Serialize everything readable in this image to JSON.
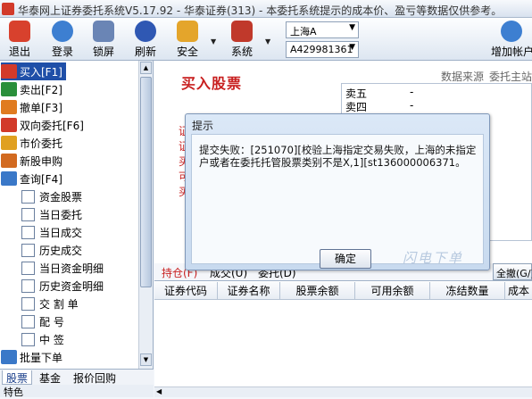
{
  "window": {
    "title": "华泰网上证券委托系统V5.17.92 - 华泰证券(313) - 本委托系统提示的成本价、盈亏等数据仅供参考。"
  },
  "toolbar": {
    "buttons": [
      {
        "label": "退出",
        "icon": "exit-icon",
        "color": "#d8412d"
      },
      {
        "label": "登录",
        "icon": "login-icon",
        "color": "#3d7fd1"
      },
      {
        "label": "锁屏",
        "icon": "lock-icon",
        "color": "#6a85b5"
      },
      {
        "label": "刷新",
        "icon": "refresh-icon",
        "color": "#2f58b3"
      },
      {
        "label": "安全",
        "icon": "security-icon",
        "color": "#e4a52b"
      },
      {
        "label": "系统",
        "icon": "system-icon",
        "color": "#c0392b"
      }
    ],
    "market": "上海A",
    "account": "A429981361",
    "add_account": "增加帐户"
  },
  "sidebar": {
    "items": [
      {
        "label": "买入[F1]",
        "icon": "buy-icon",
        "color": "#d23a2a"
      },
      {
        "label": "卖出[F2]",
        "icon": "sell-icon",
        "color": "#2a8f3a"
      },
      {
        "label": "撤单[F3]",
        "icon": "cancel-order-icon",
        "color": "#e07b20"
      },
      {
        "label": "双向委托[F6]",
        "icon": "dual-order-icon",
        "color": "#d23a2a"
      },
      {
        "label": "市价委托",
        "icon": "market-order-icon",
        "color": "#e0a020"
      },
      {
        "label": "新股申购",
        "icon": "ipo-icon",
        "color": "#d26a20"
      },
      {
        "label": "查询[F4]",
        "icon": "query-icon",
        "color": "#3a78c8"
      }
    ],
    "subitems": [
      "资金股票",
      "当日委托",
      "当日成交",
      "历史成交",
      "当日资金明细",
      "历史资金明细",
      "交 割 单",
      "配  号",
      "中  签"
    ],
    "batch": "批量下单",
    "tabs": [
      "股票",
      "基金",
      "报价回购"
    ],
    "status": "特色"
  },
  "main": {
    "heading": "买入股票",
    "source_label": "数据来源",
    "source_value": "委托主站",
    "form_labels": [
      "证",
      "证",
      "买",
      "可",
      "买"
    ],
    "orderbook": [
      {
        "label": "卖五",
        "value": "-"
      },
      {
        "label": "卖四",
        "value": "-"
      }
    ],
    "tabs": [
      "持仓(F)",
      "成交(U)",
      "委托(D)"
    ],
    "refresh_button": "全撤(G/)",
    "columns": [
      "证券代码",
      "证券名称",
      "股票余额",
      "可用余额",
      "冻结数量",
      "成本"
    ]
  },
  "dialog": {
    "title": "提示",
    "message": "提交失败：[251070][校验上海指定交易失败，上海的未指定户或者在委托托管股票类别不是X,1][st136000006371。",
    "ok": "确定",
    "watermark": "闪电下单"
  }
}
